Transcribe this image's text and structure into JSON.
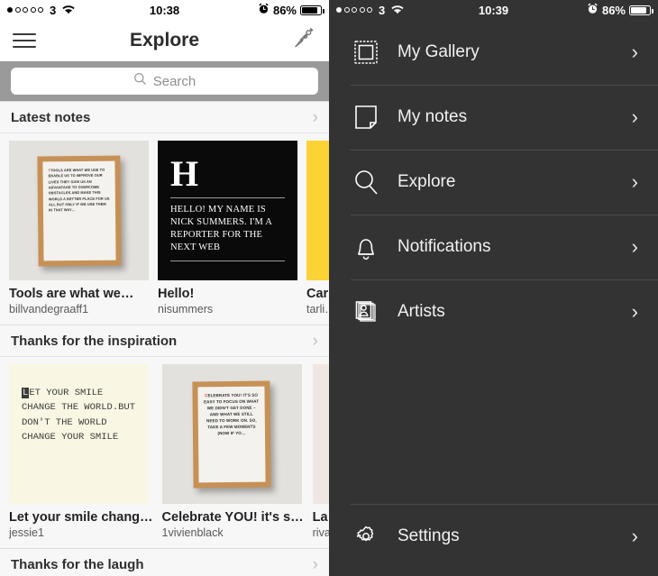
{
  "status_left": {
    "signal_dots": [
      true,
      false,
      false,
      false,
      false
    ],
    "carrier": "3",
    "wifi_icon": "wifi-icon"
  },
  "status_right": {
    "alarm_icon": "alarm-clock-icon",
    "battery_percent": "86%",
    "battery_icon": "battery-icon"
  },
  "screens": {
    "explore": {
      "time": "10:38",
      "nav": {
        "menu_icon": "hamburger-menu-icon",
        "title": "Explore",
        "compose_icon": "pen-nib-icon"
      },
      "search": {
        "icon": "search-icon",
        "placeholder": "Search",
        "value": ""
      },
      "sections": [
        {
          "title": "Latest notes",
          "chevron": "›",
          "cards": [
            {
              "title": "Tools are what we…",
              "author": "billvandegraaff1",
              "poster_text": "TOOLS ARE WHAT WE USE TO ENABLE US TO IMPROVE OUR LIVES THEY GIVE US AN ADVANTAGE TO OVERCOME OBSTACLES AND MAKE THIS WORLD A BETTER PLACE FOR US ALL BUT ONLY IF WE USE THEM IN THAT WAY…",
              "poster_first_letter": "T"
            },
            {
              "title": "Hello!",
              "author": "nisummers",
              "poster_letter": "H",
              "poster_text": "HELLO! MY NAME IS NICK SUMMERS. I'M A REPORTER FOR THE NEXT WEB"
            },
            {
              "title": "Car…",
              "author": "tarli…",
              "poster_text": ""
            }
          ]
        },
        {
          "title": "Thanks for the inspiration",
          "chevron": "›",
          "cards": [
            {
              "title": "Let your smile chang…",
              "author": "jessie1",
              "poster_first_letter": "L",
              "poster_lines": [
                "ET YOUR SMILE",
                "CHANGE THE WORLD.BUT",
                "DON'T THE WORLD",
                "CHANGE YOUR SMILE"
              ]
            },
            {
              "title": "Celebrate YOU! it's s…",
              "author": "1vivienblack",
              "poster_first_letter": "C",
              "poster_text": "ELEBRATE YOU! IT'S SO EASY TO FOCUS ON WHAT WE DIDN'T GET DONE – AND WHAT WE STILL NEED TO WORK ON. SO, TAKE A FEW MOMENTS (NOW IF YO…"
            },
            {
              "title": "La …",
              "author": "rivat…",
              "poster_text": ""
            }
          ]
        },
        {
          "title": "Thanks for the laugh",
          "chevron": "›",
          "cards": []
        }
      ]
    },
    "drawer": {
      "time": "10:39",
      "items": [
        {
          "label": "My Gallery",
          "icon": "stamp-frame-icon",
          "chevron": "›"
        },
        {
          "label": "My notes",
          "icon": "note-page-icon",
          "chevron": "›"
        },
        {
          "label": "Explore",
          "icon": "magnifier-icon",
          "chevron": "›"
        },
        {
          "label": "Notifications",
          "icon": "bell-icon",
          "chevron": "›"
        },
        {
          "label": "Artists",
          "icon": "artist-cards-icon",
          "chevron": "›"
        }
      ],
      "settings": {
        "label": "Settings",
        "icon": "gear-icon",
        "chevron": "›"
      }
    }
  },
  "colors": {
    "drawer_bg": "#333333",
    "search_bar_bg": "#9a9a9a",
    "section_bg": "#f7f7f7",
    "accent_yellow": "#fbd335",
    "frame_wood": "#c69157"
  }
}
